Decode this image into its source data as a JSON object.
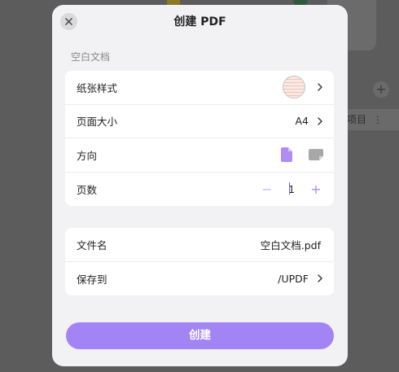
{
  "background": {
    "tag_text": "项目",
    "tag_menu": "⋮",
    "plus": "+"
  },
  "dialog": {
    "title": "创建 PDF",
    "section_label": "空白文档",
    "paper_style": {
      "label": "纸张样式"
    },
    "page_size": {
      "label": "页面大小",
      "value": "A4"
    },
    "orientation": {
      "label": "方向",
      "selected": "portrait"
    },
    "page_count": {
      "label": "页数",
      "value": "1",
      "minus": "−",
      "plus": "+"
    },
    "file_name": {
      "label": "文件名",
      "value": "空白文档.pdf"
    },
    "save_to": {
      "label": "保存到",
      "value": "/UPDF"
    },
    "create_button": "创建"
  },
  "colors": {
    "accent": "#a384f4",
    "accent_icon": "#b08cf5",
    "inactive_icon": "#a8a8a8"
  }
}
